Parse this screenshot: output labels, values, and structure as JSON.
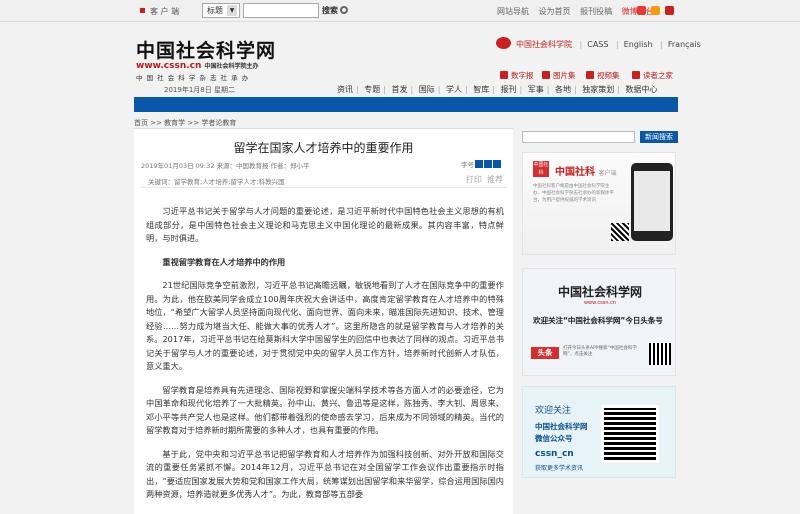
{
  "topbar": {
    "client": "客 户 端",
    "select": "标题",
    "search": "搜索",
    "links": [
      "网站导航",
      "设为首页",
      "报刊投稿"
    ],
    "weibo": "微博平台"
  },
  "header": {
    "logo": "中国社会科学网",
    "url": "www.cssn.cn",
    "url_note": "中国社会科学院主办",
    "sub": "中 国 社 会 科 学 杂 志 社 承 办",
    "cass_site": "中国社会科学院",
    "lang": [
      "CASS",
      "English",
      "Français"
    ],
    "features": [
      "数字报",
      "图片集",
      "视频集",
      "读者之家"
    ],
    "date": "2019年1月8日 星期二",
    "nav": [
      "资讯",
      "专题",
      "首发",
      "国际",
      "学人",
      "智库",
      "报刊",
      "军事",
      "各地",
      "独家策划",
      "数据中心"
    ]
  },
  "breadcrumb": "首页 >> 教育学 >> 学者论教育",
  "article": {
    "title": "留学在国家人才培养中的重要作用",
    "meta": "2019年01月03日 09:32 来源：中国教育报 作者：郑小平",
    "font_label": "字号",
    "keywords": "关键词：留学教育;人才培养;留学人才;科教兴国",
    "print": "打印",
    "recommend": "推荐",
    "p1": "习近平总书记关于留学与人才问题的重要论述，是习近平新时代中国特色社会主义思想的有机组成部分，是中国特色社会主义理论和马克思主义中国化理论的最新成果。其内容丰富，特点鲜明，与时俱进。",
    "subhead": "重视留学教育在人才培养中的作用",
    "p2": "21世纪国际竞争空前激烈，习近平总书记高瞻远瞩，敏锐地看到了人才在国际竞争中的重要作用。为此，他在欧美同学会成立100周年庆祝大会讲话中，高度肯定留学教育在人才培养中的特殊地位，“希望广大留学人员坚持面向现代化、面向世界、面向未来，瞄准国际先进知识、技术、管理经验……努力成为堪当大任、能做大事的优秀人才”。这里所隐含的就是留学教育与人才培养的关系。2017年，习近平总书记在给莫斯科大学中国留学生的回信中也表达了同样的观点。习近平总书记关于留学与人才的重要论述，对于贯彻党中央的留学人员工作方针，培养新时代创新人才队伍，意义重大。",
    "p3": "留学教育是培养具有先进理念、国际视野和掌握尖端科学技术等各方面人才的必要途径，它为中国革命和现代化培养了一大批精英。孙中山、黄兴、鲁迅等是这样，陈独秀、李大钊、周恩来、邓小平等共产党人也是这样。他们都带着强烈的使命感去学习，后来成为不同领域的精英。当代的留学教育对于培养新时期所需要的多种人才，也具有重要的作用。",
    "p4": "基于此，党中央和习近平总书记把留学教育和人才培养作为加强科技创新、对外开放和国际交流的重要任务紧抓不懈。2014年12月，习近平总书记在对全国留学工作会议作出重要指示时指出，“要适应国家发展大势和党和国家工作大局，统筹谋划出国留学和来华留学，综合运用国际国内两种资源，培养造就更多优秀人才”。为此，教育部等五部委"
  },
  "sidebar": {
    "search_button": "新闻搜索",
    "app_ad": {
      "icon_text": "中国社科",
      "name": "中国社科",
      "suffix": "客户端",
      "desc": "中国社科客户端是由中国社会科学院主办、中国社会科学杂志社承办的新媒体平台，为用户提供权威的学术资讯"
    },
    "toutiao_ad": {
      "logo": "中国社会科学网",
      "url": "www.cssn.cn",
      "caption": "欢迎关注“中国社会科学网”今日头条号",
      "badge": "头条",
      "desc": "打开今日头条APP搜索“中国社会科学网”，点击关注"
    },
    "wechat_ad": {
      "line1": "欢迎关注",
      "line2": "中国社会科学网",
      "line3": "微信公众号",
      "handle": "cssn_cn",
      "tagline": "获取更多学术资讯"
    }
  },
  "colors": {
    "brand_red": "#c62222",
    "brand_blue": "#0a57a8"
  }
}
